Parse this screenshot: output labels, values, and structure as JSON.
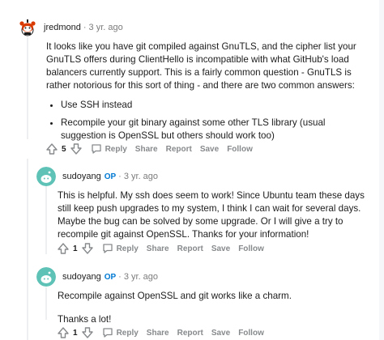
{
  "comments": [
    {
      "username": "jredmond",
      "op": "",
      "time": "3 yr. ago",
      "paragraphs": [
        "It looks like you have git compiled against GnuTLS, and the cipher list your GnuTLS offers during ClientHello is incompatible with what GitHub's load balancers currently support. This is a fairly common question - GnuTLS is rather notorious for this sort of thing - and there are two common answers:"
      ],
      "bullets": [
        "Use SSH instead",
        "Recompile your git binary against some other TLS library (usual suggestion is OpenSSL but others should work too)"
      ],
      "votes": "5"
    },
    {
      "username": "sudoyang",
      "op": "OP",
      "time": "3 yr. ago",
      "paragraphs": [
        "This is helpful. My ssh does seem to work! Since Ubuntu team these days still keep push upgrades to my system, I think I can wait for several days. Maybe the bug can be solved by some upgrade. Or I will give a try to recompile git against OpenSSL. Thanks for your information!"
      ],
      "votes": "1"
    },
    {
      "username": "sudoyang",
      "op": "OP",
      "time": "3 yr. ago",
      "paragraphs": [
        "Recompile against OpenSSL and git works like a charm.",
        "Thanks a lot!"
      ],
      "votes": "1"
    }
  ],
  "actions": {
    "reply": "Reply",
    "share": "Share",
    "report": "Report",
    "save": "Save",
    "follow": "Follow"
  },
  "separator": "·",
  "colors": {
    "op_blue": "#0079d3",
    "meta_gray": "#7c7c7c",
    "rail": "#edeff1",
    "avatar_teal": "#5ec2b7"
  },
  "icons": {
    "upvote": "arrow-up-icon",
    "downvote": "arrow-down-icon",
    "reply": "speech-bubble-icon"
  }
}
